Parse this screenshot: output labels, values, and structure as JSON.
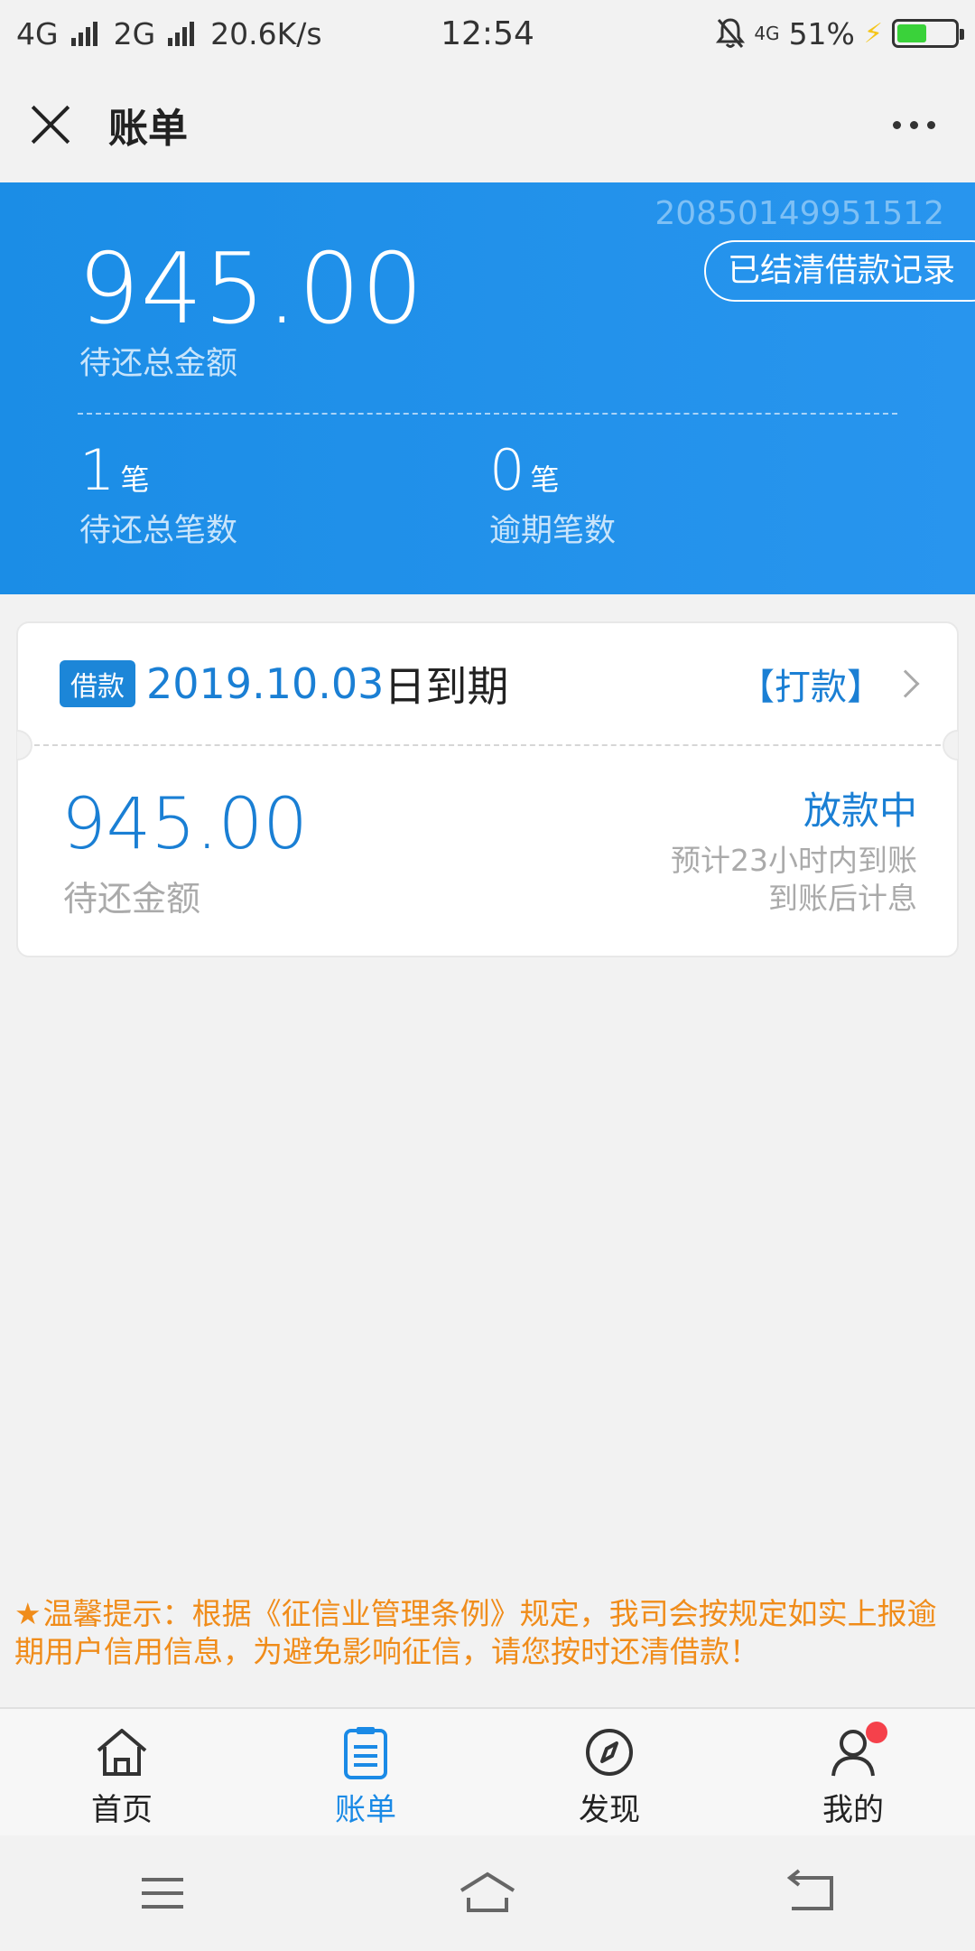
{
  "status_bar": {
    "network1": "4G",
    "network2": "2G",
    "speed": "20.6K/s",
    "time": "12:54",
    "net_small": "4G",
    "battery": "51%",
    "battery_level": 0.51,
    "battery_color": "#3ad23a"
  },
  "nav": {
    "title": "账单"
  },
  "hero": {
    "id": "20850149951512",
    "settled_button": "已结清借款记录",
    "total_amount": "945.00",
    "total_amount_label": "待还总金额",
    "pending_count": "1",
    "pending_unit": "笔",
    "pending_label": "待还总笔数",
    "overdue_count": "0",
    "overdue_unit": "笔",
    "overdue_label": "逾期笔数",
    "color": "#1b8de6"
  },
  "loan_card": {
    "tag": "借款",
    "due_date": "2019.10.03",
    "due_suffix": "日到期",
    "pay_link": "【打款】",
    "amount": "945.00",
    "amount_label": "待还金额",
    "status": "放款中",
    "note1": "预计23小时内到账",
    "note2": "到账后计息"
  },
  "notice": {
    "star": "★",
    "text": "温馨提示：根据《征信业管理条例》规定，我司会按规定如实上报逾期用户信用信息，为避免影响征信，请您按时还清借款！",
    "color": "#f08c1a"
  },
  "tabbar": {
    "items": [
      {
        "label": "首页",
        "icon": "home-icon"
      },
      {
        "label": "账单",
        "icon": "bill-icon"
      },
      {
        "label": "发现",
        "icon": "compass-icon"
      },
      {
        "label": "我的",
        "icon": "user-icon"
      }
    ],
    "active_color": "#1a8ae6"
  },
  "system_nav": {
    "icons": [
      "menu-icon",
      "home-outline-icon",
      "back-icon"
    ]
  }
}
